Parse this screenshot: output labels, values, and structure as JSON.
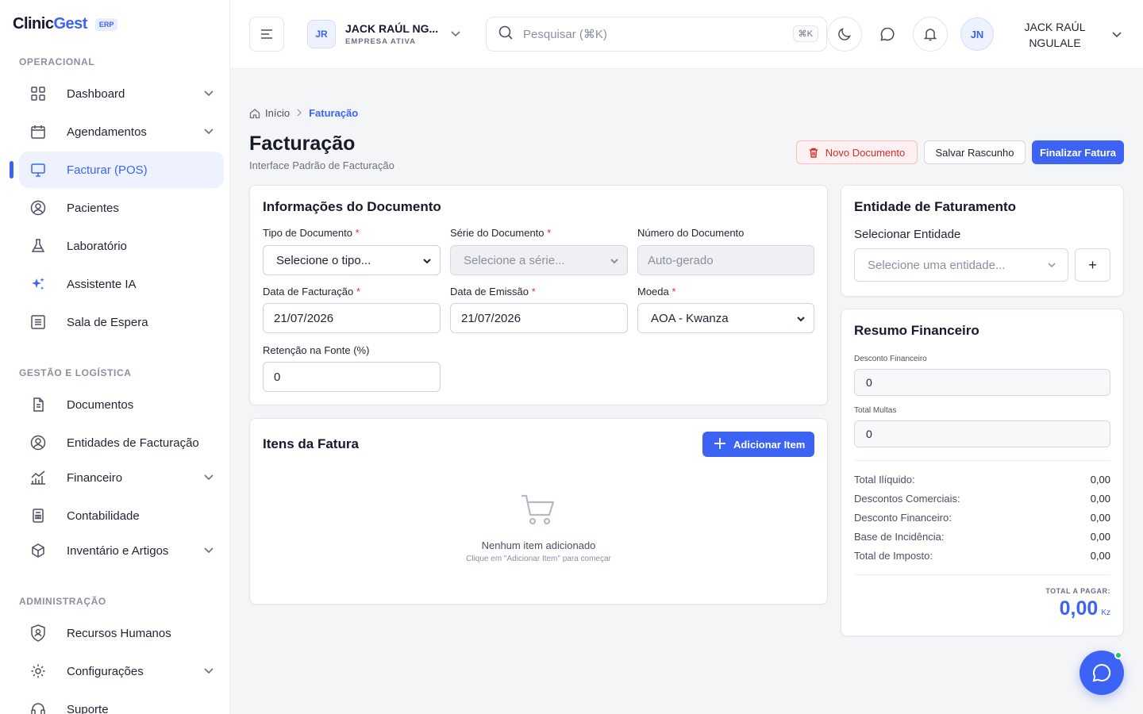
{
  "app": {
    "brand_main": "Clinic",
    "brand_accent": "Gest",
    "brand_badge": "ERP",
    "accent_color": "#3d63f5"
  },
  "sidebar": {
    "sections": [
      {
        "title": "OPERACIONAL"
      },
      {
        "title": "GESTÃO E LOGÍSTICA"
      },
      {
        "title": "ADMINISTRAÇÃO"
      }
    ],
    "items": [
      {
        "label": "Dashboard",
        "icon": "grid-icon",
        "has_submenu": true
      },
      {
        "label": "Agendamentos",
        "icon": "calendar-icon",
        "has_submenu": true
      },
      {
        "label": "Facturar (POS)",
        "icon": "monitor-icon",
        "active": true
      },
      {
        "label": "Pacientes",
        "icon": "user-circle-icon"
      },
      {
        "label": "Laboratório",
        "icon": "flask-icon"
      },
      {
        "label": "Assistente IA",
        "icon": "sparkles-icon"
      },
      {
        "label": "Sala de Espera",
        "icon": "list-icon"
      },
      {
        "label": "Documentos",
        "icon": "document-icon"
      },
      {
        "label": "Entidades de Facturação",
        "icon": "user-circle-icon"
      },
      {
        "label": "Financeiro",
        "icon": "chart-icon",
        "has_submenu": true
      },
      {
        "label": "Contabilidade",
        "icon": "calculator-icon"
      },
      {
        "label": "Inventário e Artigos",
        "icon": "box-icon",
        "has_submenu": true
      },
      {
        "label": "Recursos Humanos",
        "icon": "shield-user-icon"
      },
      {
        "label": "Configurações",
        "icon": "gear-icon",
        "has_submenu": true
      },
      {
        "label": "Suporte",
        "icon": "headset-icon"
      }
    ]
  },
  "header": {
    "company_initials": "JR",
    "company_name": "JACK RAÚL NG...",
    "company_status": "EMPRESA ATIVA",
    "search_placeholder": "Pesquisar (⌘K)",
    "search_shortcut": "⌘K",
    "user_initials": "JN",
    "user_name": "JACK RAÚL NGULALE"
  },
  "breadcrumb": {
    "home": "Início",
    "current": "Faturação"
  },
  "page": {
    "title": "Facturação",
    "subtitle": "Interface Padrão de Facturação",
    "btn_new": "Novo Documento",
    "btn_draft": "Salvar Rascunho",
    "btn_finalize": "Finalizar Fatura"
  },
  "doc_info": {
    "title": "Informações do Documento",
    "tipo_label": "Tipo de Documento",
    "tipo_value": "Selecione o tipo...",
    "serie_label": "Série do Documento",
    "serie_value": "Selecione a série...",
    "numero_label": "Número do Documento",
    "numero_placeholder": "Auto-gerado",
    "data_fact_label": "Data de Facturação",
    "data_fact_value": "21/07/2026",
    "data_emis_label": "Data de Emissão",
    "data_emis_value": "21/07/2026",
    "moeda_label": "Moeda",
    "moeda_value": "AOA - Kwanza",
    "retencao_label": "Retenção na Fonte (%)",
    "retencao_value": "0",
    "required_mark": "*"
  },
  "items": {
    "title": "Itens da Fatura",
    "add_label": "Adicionar Item",
    "empty_title": "Nenhum item adicionado",
    "empty_hint": "Clique em \"Adicionar Item\" para começar"
  },
  "entity": {
    "title": "Entidade de Faturamento",
    "select_label": "Selecionar Entidade",
    "select_placeholder": "Selecione uma entidade...",
    "add_symbol": "+"
  },
  "summary": {
    "title": "Resumo Financeiro",
    "desconto_label": "Desconto Financeiro",
    "desconto_value": "0",
    "multas_label": "Total Multas",
    "multas_value": "0",
    "rows": [
      {
        "label": "Total Ilíquido:",
        "value": "0,00"
      },
      {
        "label": "Descontos Comerciais:",
        "value": "0,00"
      },
      {
        "label": "Desconto Financeiro:",
        "value": "0,00"
      },
      {
        "label": "Base de Incidência:",
        "value": "0,00"
      },
      {
        "label": "Total de Imposto:",
        "value": "0,00"
      }
    ],
    "total_label": "TOTAL A PAGAR:",
    "total_value": "0,00",
    "total_currency": "Kz"
  }
}
